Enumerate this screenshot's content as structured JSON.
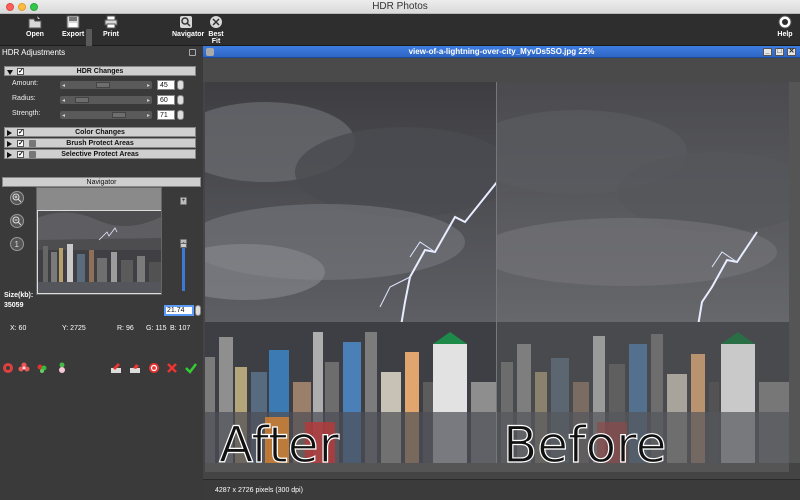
{
  "app": {
    "title": "HDR Photos"
  },
  "toolbar": {
    "open": "Open",
    "export": "Export",
    "print": "Print",
    "navigator": "Navigator",
    "best_fit": "Best Fit",
    "help": "Help"
  },
  "hdr_panel": {
    "title": "HDR Adjustments",
    "hdr_changes": "HDR Changes",
    "sliders": [
      {
        "label": "Amount:",
        "value": "45",
        "level": 0.45
      },
      {
        "label": "Radius:",
        "value": "60",
        "level": 0.12
      },
      {
        "label": "Strength:",
        "value": "71",
        "level": 0.71
      }
    ],
    "groups": [
      {
        "label": "Color Changes"
      },
      {
        "label": "Brush Protect Areas"
      },
      {
        "label": "Selective Protect Areas"
      }
    ]
  },
  "navigator": {
    "title": "Navigator",
    "size_label": "Size(kb):",
    "size_value": "35059",
    "zoom": "21.74",
    "stats": {
      "x": "X: 60",
      "y": "Y: 2725",
      "r": "R: 96",
      "g": "G: 115",
      "b": "B: 107"
    }
  },
  "document": {
    "title": "view-of-a-lightning-over-city_MyvDs5SO.jpg 22%",
    "after_label": "After",
    "before_label": "Before",
    "status": "4287 x 2726 pixels (300 dpi)"
  },
  "colors": {
    "accent": "#3b78d8",
    "title_blue": "#2f66c4"
  }
}
